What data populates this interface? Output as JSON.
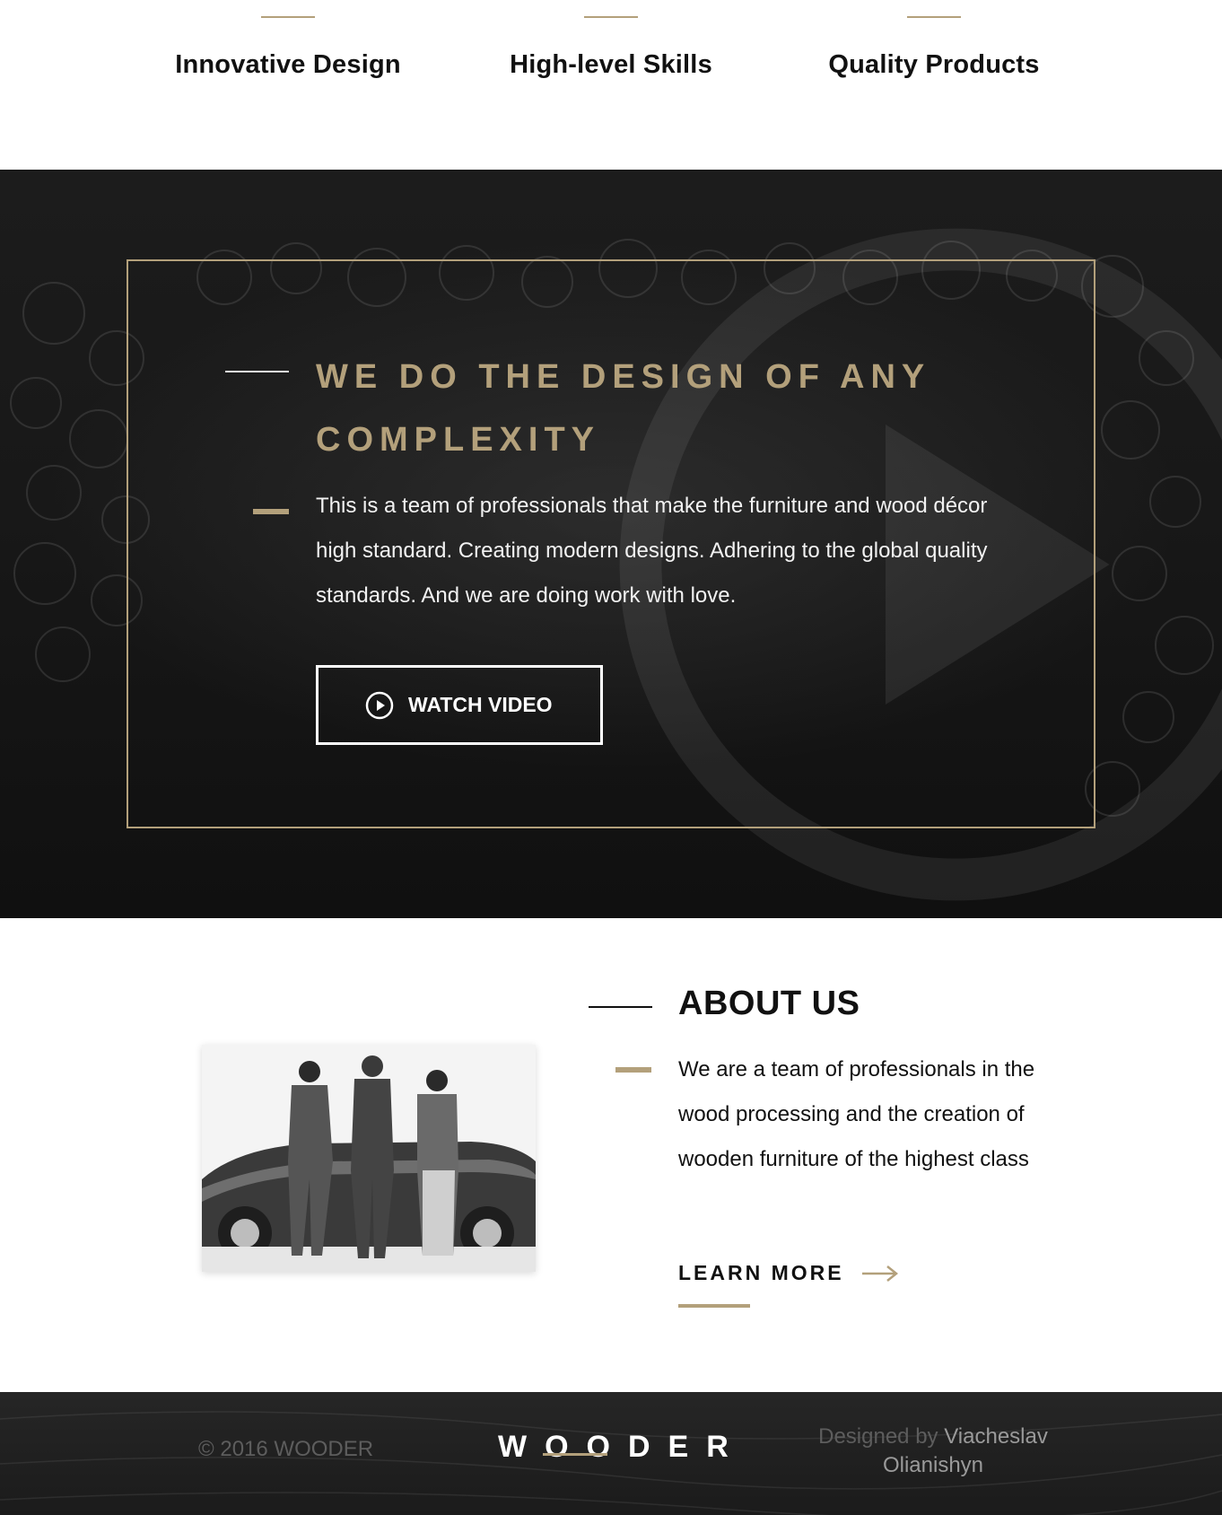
{
  "features": [
    {
      "title": "Innovative Design"
    },
    {
      "title": "High-level Skills"
    },
    {
      "title": "Quality Products"
    }
  ],
  "hero": {
    "title": "WE DO THE DESIGN OF ANY COMPLEXITY",
    "text": "This is a team of professionals that make the furniture and wood décor high standard. Creating modern designs. Adhering to the global quality standards. And we are doing work with love.",
    "watch_button": {
      "label": "WATCH VIDEO",
      "icon": "play-circle-icon"
    },
    "background_icon": "play-icon"
  },
  "about": {
    "title": "ABOUT US",
    "text": "We are a team of professionals in the wood processing and the creation of wooden furniture of the highest class",
    "learn_more": {
      "label": "LEARN MORE",
      "icon": "arrow-right-icon"
    },
    "photo_alt": "three men in suits leaning on a vintage car"
  },
  "footer": {
    "copyright": "© 2016 WOODER",
    "logo": "WOODER",
    "credit_prefix": "Designed by",
    "credit_name": "Viacheslav Olianishyn"
  },
  "colors": {
    "accent": "#b3a07b",
    "dark": "#151515",
    "text": "#111111",
    "muted": "#5d5d5d"
  }
}
